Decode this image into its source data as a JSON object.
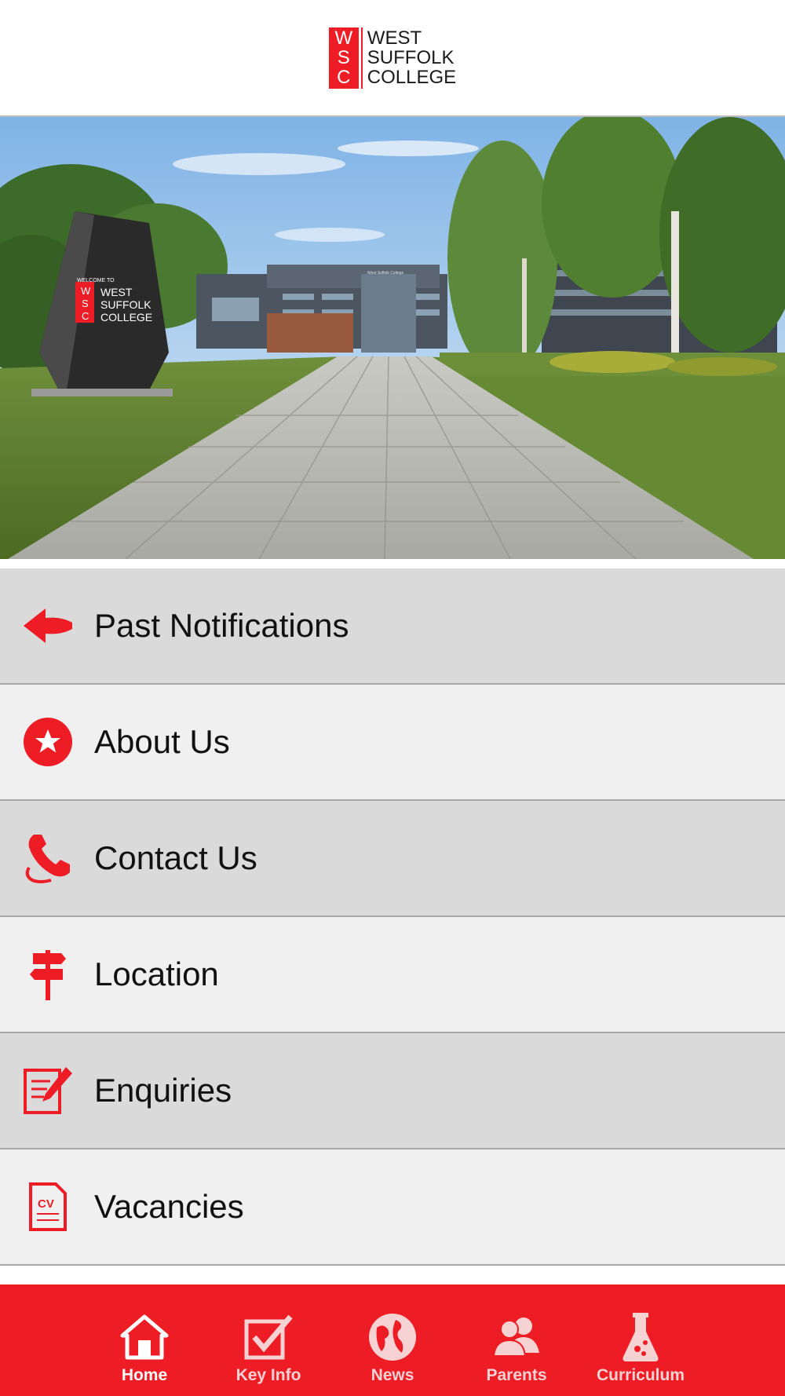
{
  "header": {
    "logo": {
      "letters": [
        "W",
        "S",
        "C"
      ],
      "lines": [
        "WEST",
        "SUFFOLK",
        "COLLEGE"
      ]
    }
  },
  "hero": {
    "sign": {
      "welcome": "WELCOME TO",
      "letters": [
        "W",
        "S",
        "C"
      ],
      "lines": [
        "WEST",
        "SUFFOLK",
        "COLLEGE"
      ]
    },
    "building_sign": "West Suffolk College"
  },
  "menu": {
    "items": [
      {
        "label": "Past Notifications",
        "icon": "arrow-left-icon"
      },
      {
        "label": "About Us",
        "icon": "star-circle-icon"
      },
      {
        "label": "Contact Us",
        "icon": "phone-icon"
      },
      {
        "label": "Location",
        "icon": "signpost-icon"
      },
      {
        "label": "Enquiries",
        "icon": "form-pencil-icon"
      },
      {
        "label": "Vacancies",
        "icon": "cv-document-icon"
      }
    ]
  },
  "tabbar": {
    "tabs": [
      {
        "label": "Home",
        "icon": "home-icon",
        "active": true
      },
      {
        "label": "Key Info",
        "icon": "checkbox-icon",
        "active": false
      },
      {
        "label": "News",
        "icon": "globe-icon",
        "active": false
      },
      {
        "label": "Parents",
        "icon": "people-icon",
        "active": false
      },
      {
        "label": "Curriculum",
        "icon": "flask-icon",
        "active": false
      }
    ]
  },
  "colors": {
    "brand_red": "#ee1c25",
    "menu_dark": "#dadada",
    "menu_light": "#f0f0f0",
    "divider": "#a9a9a9"
  }
}
